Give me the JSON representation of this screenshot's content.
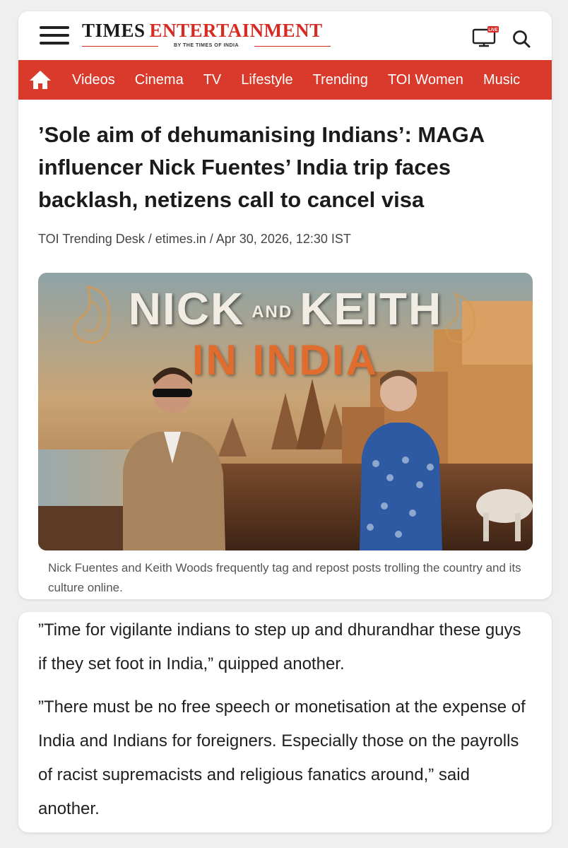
{
  "header": {
    "logo_main_1": "TIMES",
    "logo_main_2": "ENTERTAINMENT",
    "logo_sub": "BY THE TIMES OF INDIA",
    "live_badge": "LIVE",
    "icons": [
      "menu-icon",
      "live-tv-icon",
      "search-icon"
    ]
  },
  "nav": {
    "home_icon": "home-icon",
    "items": [
      "Videos",
      "Cinema",
      "TV",
      "Lifestyle",
      "Trending",
      "TOI Women",
      "Music"
    ]
  },
  "article": {
    "headline": "’Sole aim of dehumanising Indians’: MAGA influencer Nick Fuentes’ India trip faces backlash, netizens call to cancel visa",
    "byline": "TOI Trending Desk / etimes.in / Apr 30, 2026, 12:30 IST",
    "image_text_line1_a": "NICK",
    "image_text_line1_and": "AND",
    "image_text_line1_b": "KEITH",
    "image_text_line2": "IN INDIA",
    "caption": "Nick Fuentes and Keith Woods frequently tag and repost posts trolling the country and its culture online.",
    "paragraphs": [
      "”Time for vigilante indians to step up and dhurandhar these guys if they set foot in India,” quipped another.",
      "”There must be no free speech or monetisation at the expense of India and Indians for foreigners. Especially those on the payrolls of racist supremacists and religious fanatics around,” said another."
    ]
  },
  "colors": {
    "brand_red": "#d62b23",
    "nav_bg": "#d93a2b",
    "title_orange": "#e06d2e"
  }
}
